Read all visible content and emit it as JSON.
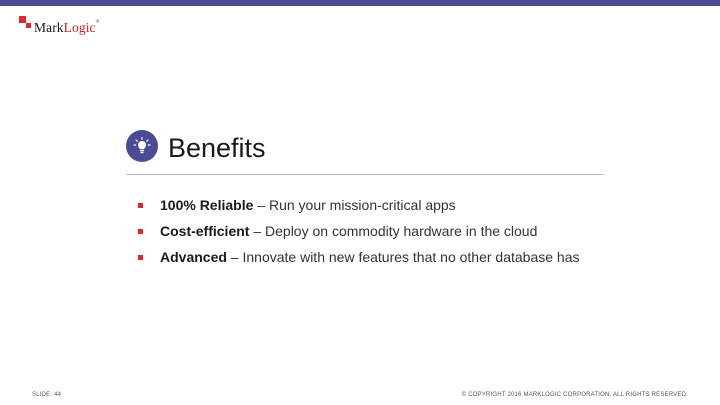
{
  "logo": {
    "mark": "Mark",
    "logic": "Logic",
    "tm": "®"
  },
  "slide": {
    "title": "Benefits",
    "title_icon": "lightbulb-icon",
    "bullets": [
      {
        "bold": "100% Reliable",
        "text": " – Run your mission-critical apps"
      },
      {
        "bold": "Cost-efficient",
        "text": " – Deploy on commodity hardware in the cloud"
      },
      {
        "bold": "Advanced",
        "text": " – Innovate with new features that no other database has"
      }
    ]
  },
  "footer": {
    "slide_number": "SLIDE: 44",
    "copyright": "© COPYRIGHT 2016 MARKLOGIC CORPORATION. ALL RIGHTS RESERVED."
  },
  "colors": {
    "accent_bar": "#4a4a96",
    "bullet": "#e0282f",
    "brand_red": "#c8202a"
  }
}
